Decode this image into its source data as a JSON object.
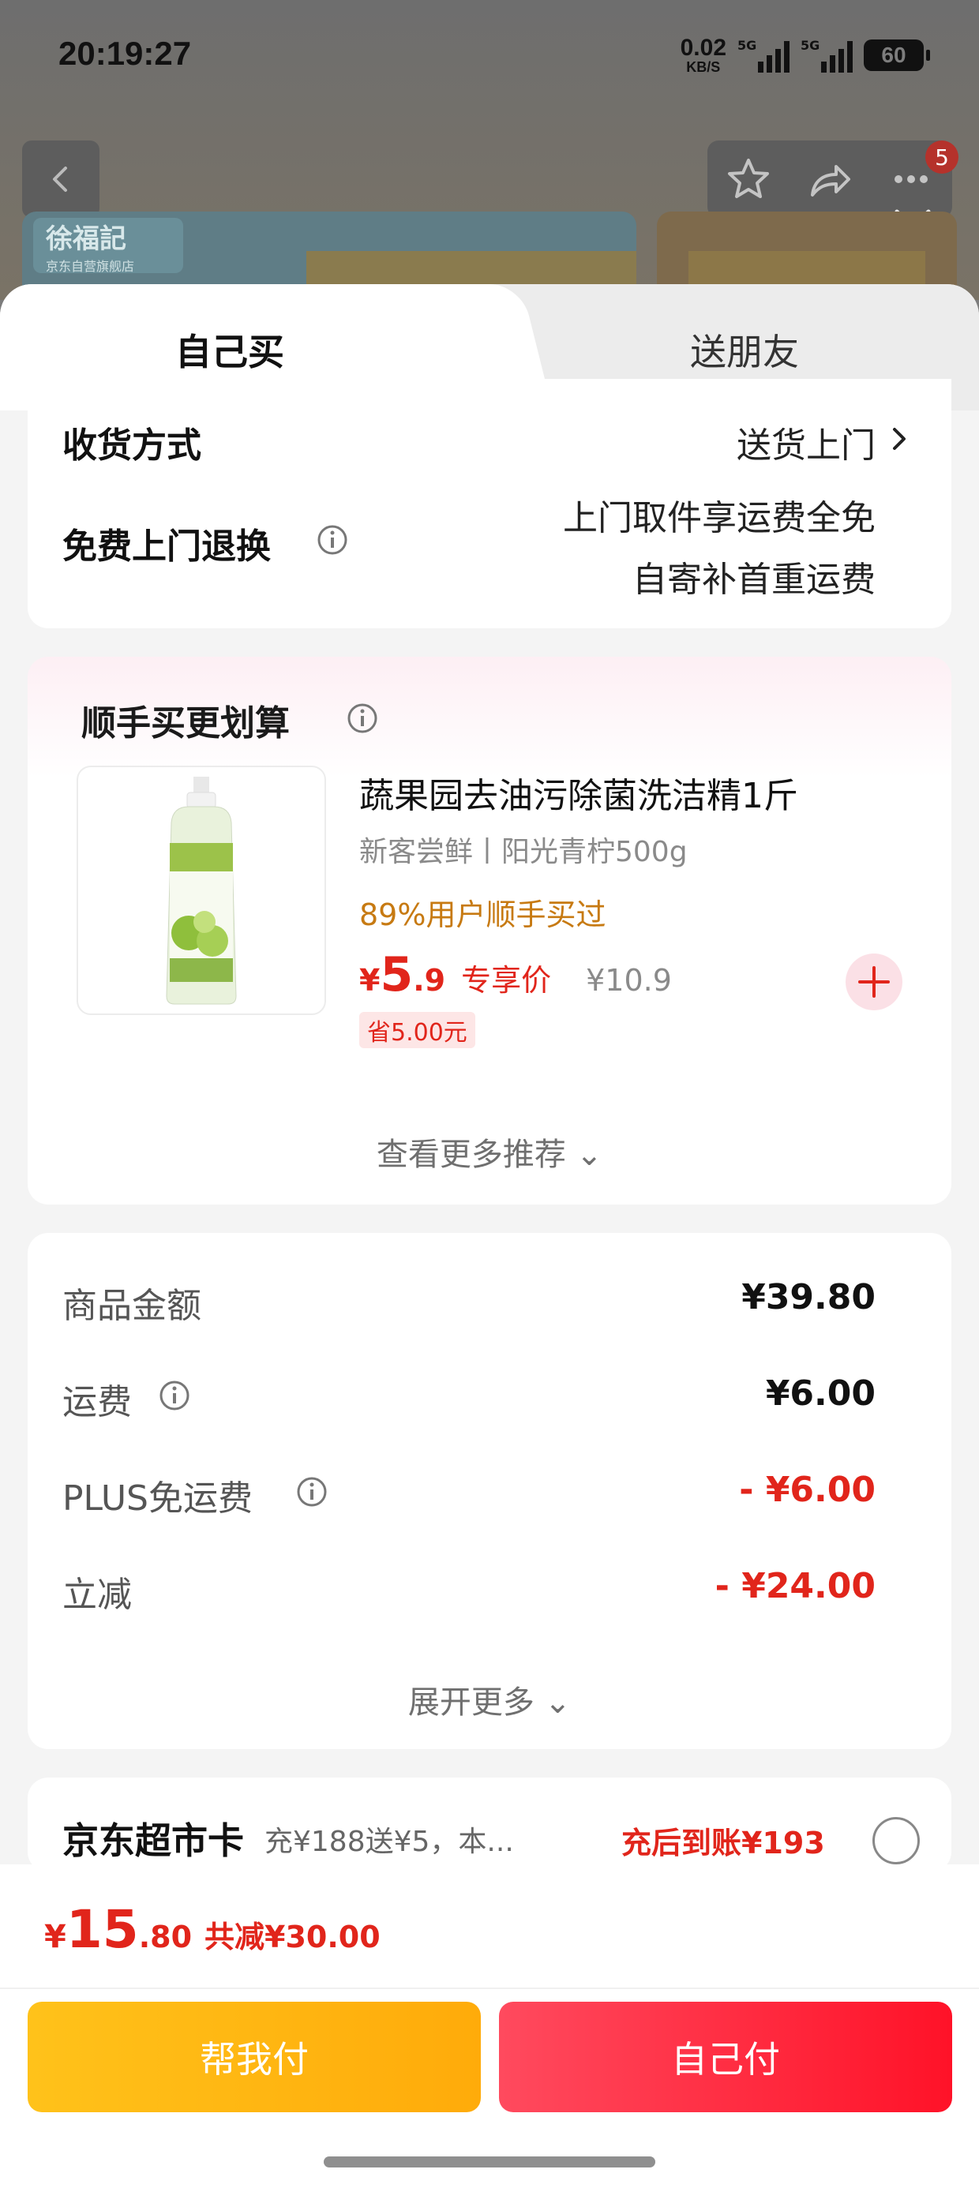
{
  "status_bar": {
    "time": "20:19:27",
    "net_speed_value": "0.02",
    "net_speed_unit": "KB/S",
    "signal_tag_1": "5G",
    "signal_tag_2": "5G",
    "battery": "60"
  },
  "nav": {
    "back_icon": "chevron-left-icon",
    "actions": [
      "star-icon",
      "share-icon",
      "more-icon"
    ],
    "badge_count": "5",
    "close_icon": "close-icon"
  },
  "banner": {
    "store_logo": "徐福記",
    "store_sub": "京东自营旗舰店"
  },
  "tabs": {
    "self": "自己买",
    "friend": "送朋友"
  },
  "delivery": {
    "method_label": "收货方式",
    "method_value": "送货上门",
    "return_label": "免费上门退换",
    "return_line1": "上门取件享运费全免",
    "return_line2": "自寄补首重运费"
  },
  "recommend": {
    "title": "顺手买更划算",
    "product": {
      "name": "蔬果园去油污除菌洗洁精1斤",
      "spec": "新客尝鲜丨阳光青柠500g",
      "social": "89%用户顺手买过",
      "currency": "¥",
      "price_int": "5",
      "price_dec": ".9",
      "price_tag": "专享价",
      "orig_price": "¥10.9",
      "save": "省5.00元"
    },
    "more": "查看更多推荐"
  },
  "summary": {
    "rows": [
      {
        "label": "商品金额",
        "value": "¥39.80"
      },
      {
        "label": "运费",
        "value": "¥6.00"
      },
      {
        "label": "PLUS免运费",
        "value": "- ¥6.00"
      },
      {
        "label": "立减",
        "value": "- ¥24.00"
      }
    ],
    "expand": "展开更多"
  },
  "recharge": {
    "title": "京东超市卡",
    "sub": "充¥188送¥5，本...",
    "right": "充后到账¥193"
  },
  "bottom": {
    "currency": "¥",
    "total_int": "15",
    "total_dec": ".80",
    "total_save": "共减¥30.00",
    "help_pay": "帮我付",
    "self_pay": "自己付"
  },
  "colors": {
    "accent_red": "#e1251b",
    "help_yellow": "#ffb70f",
    "pay_red": "#ff2a3f",
    "social_orange": "#c77a12"
  }
}
